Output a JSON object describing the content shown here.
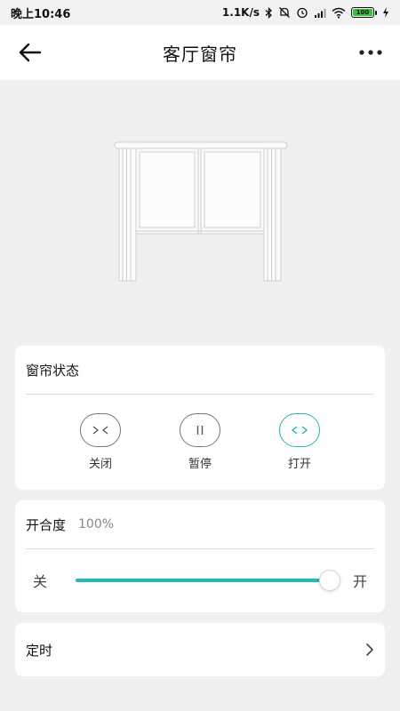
{
  "status_bar": {
    "time": "晚上10:46",
    "net_speed": "1.1K/s",
    "battery": "100"
  },
  "header": {
    "title": "客厅窗帘"
  },
  "curtain_status": {
    "title": "窗帘状态",
    "buttons": [
      {
        "label": "关闭"
      },
      {
        "label": "暂停"
      },
      {
        "label": "打开"
      }
    ],
    "active": "打开"
  },
  "openness": {
    "title": "开合度",
    "value_text": "100%",
    "value": 100,
    "left_label": "关",
    "right_label": "开"
  },
  "timer": {
    "title": "定时"
  },
  "colors": {
    "accent": "#1fbbb4",
    "background": "#f0f0f0"
  }
}
